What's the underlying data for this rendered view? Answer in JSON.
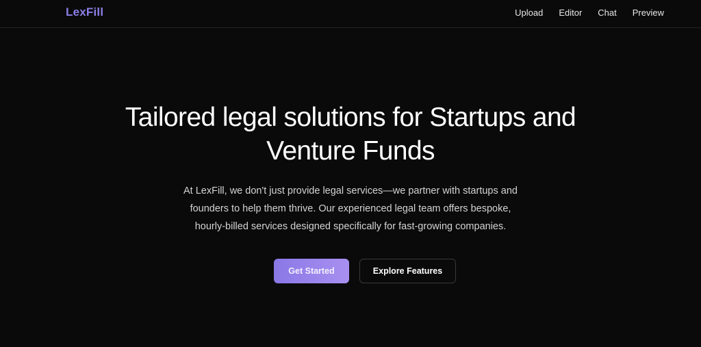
{
  "nav": {
    "logo": "LexFill",
    "links": [
      "Upload",
      "Editor",
      "Chat",
      "Preview"
    ]
  },
  "hero": {
    "headline_line1": "Tailored legal solutions for Startups and",
    "headline_line2": "Venture Funds",
    "description_line1": "At LexFill, we don't just provide legal services—we partner with startups and",
    "description_line2": "founders to help them thrive. Our experienced legal team offers bespoke,",
    "description_line3": "hourly-billed services designed specifically for fast-growing companies.",
    "primary_button": "Get Started",
    "secondary_button": "Explore Features"
  },
  "colors": {
    "background": "#0a0a0a",
    "accent": "#8b7fe8",
    "text": "#ffffff",
    "muted_text": "#d4d4d4"
  }
}
